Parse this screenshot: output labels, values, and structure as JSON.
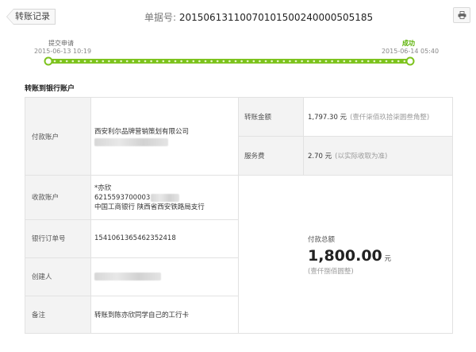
{
  "header": {
    "back_label": "转账记录",
    "receipt_label": "单据号:",
    "receipt_number": "20150613110070101500240000505185"
  },
  "progress": {
    "start_label": "提交申请",
    "start_time": "2015-06-13 10:19",
    "end_label": "成功",
    "end_time": "2015-06-14 05:40",
    "color": "#7dc31e",
    "level": 1.0
  },
  "section_title": "转账到银行账户",
  "details": {
    "payer_label": "付款账户",
    "payer_name": "西安利尔品牌营销策划有限公司",
    "payee_label": "收款账户",
    "payee_name": "*亦欣",
    "payee_account": "6215593700003",
    "payee_bank": "中国工商银行 陕西省西安铁路局支行",
    "order_label": "银行订单号",
    "order_no": "1541061365462352418",
    "creator_label": "创建人",
    "remark_label": "备注",
    "remark": "转账到陈亦欣同学自己的工行卡",
    "amount_label": "转账金额",
    "amount_value": "1,797.30 元",
    "amount_words": "(壹仟柒佰玖拾柒圆叁角整)",
    "fee_label": "服务费",
    "fee_value": "2.70 元",
    "fee_note": "(以实际收取为准)",
    "total_label": "付款总额",
    "total_value": "1,800.00",
    "total_unit": "元",
    "total_words": "(壹仟捌佰圆整)"
  }
}
